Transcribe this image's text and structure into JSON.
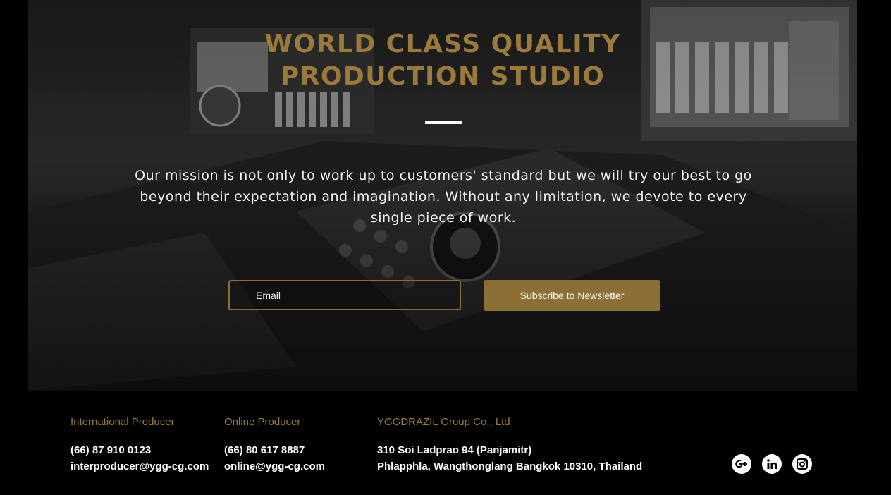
{
  "hero": {
    "title_line1": "WORLD CLASS QUALITY",
    "title_line2": "PRODUCTION STUDIO",
    "mission": "Our mission is not only to work up to customers' standard but we will try our best to go beyond their expectation and imagination. Without any limitation, we devote to every single piece of work."
  },
  "newsletter": {
    "email_placeholder": "Email",
    "email_value": "",
    "subscribe_label": "Subscribe to Newsletter"
  },
  "footer": {
    "international": {
      "heading": "International Producer",
      "phone": "(66) 87 910 0123",
      "email": "interproducer@ygg-cg.com"
    },
    "online": {
      "heading": "Online Producer",
      "phone": "(66) 80 617 8887",
      "email": "online@ygg-cg.com"
    },
    "company": {
      "heading": "YGGDRAZIL Group Co., Ltd",
      "address_line1": "310 Soi Ladprao 94 (Panjamitr)",
      "address_line2": "Phlapphla, Wangthonglang Bangkok 10310, Thailand"
    },
    "socials": [
      {
        "icon": "google-plus-icon"
      },
      {
        "icon": "linkedin-icon"
      },
      {
        "icon": "instagram-icon"
      }
    ]
  },
  "colors": {
    "gold": "#9a7b3a",
    "button_gold": "#8c6f34",
    "background": "#000000",
    "text": "#ffffff"
  }
}
